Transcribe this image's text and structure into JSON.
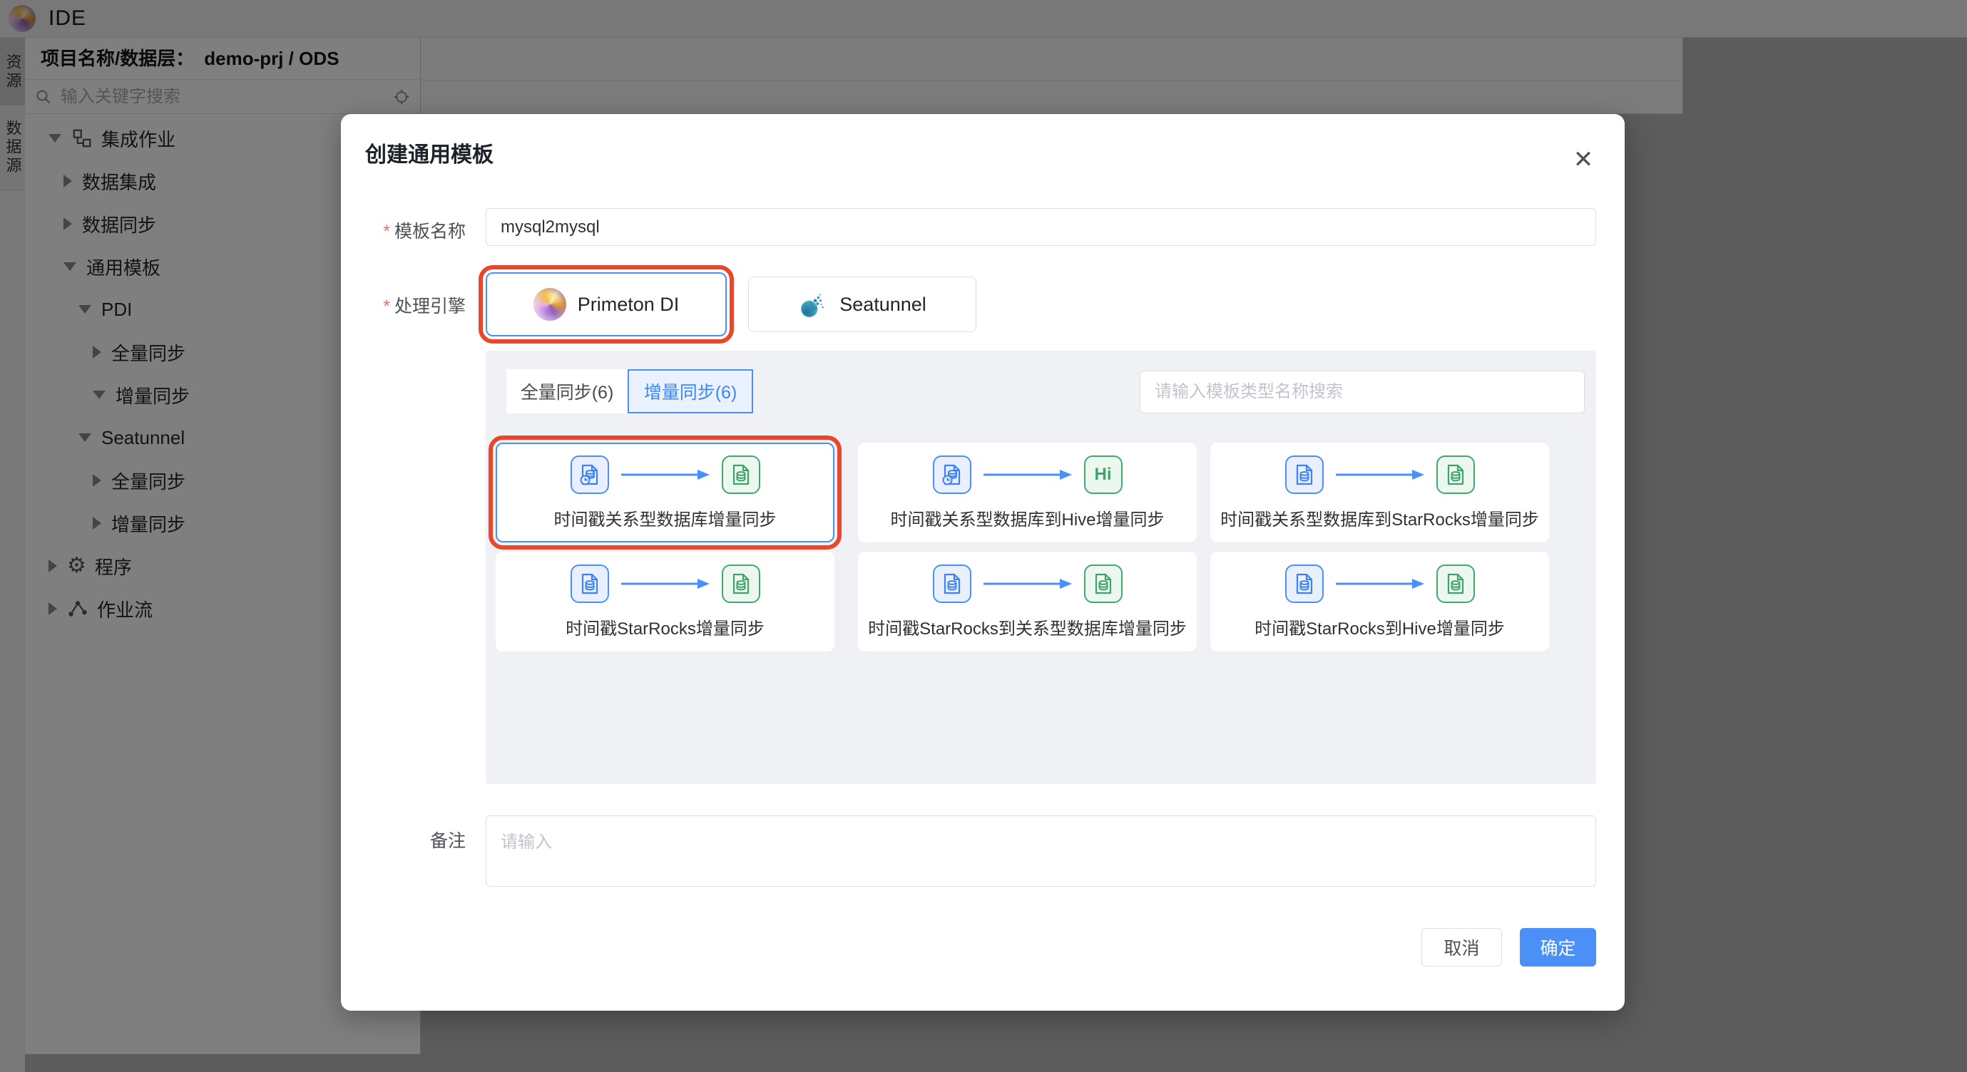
{
  "app": {
    "title": "IDE"
  },
  "rail": {
    "tabs": [
      {
        "label": "资源",
        "active": true
      },
      {
        "label": "数据源",
        "active": false
      }
    ]
  },
  "sidebar": {
    "project_label": "项目名称/数据层：",
    "project_value": "demo-prj / ODS",
    "search_placeholder": "输入关键字搜索",
    "tree": [
      {
        "label": "集成作业",
        "level": 0,
        "expanded": true,
        "icon": "hierarchy"
      },
      {
        "label": "数据集成",
        "level": 1,
        "expanded": false
      },
      {
        "label": "数据同步",
        "level": 1,
        "expanded": false
      },
      {
        "label": "通用模板",
        "level": 1,
        "expanded": true
      },
      {
        "label": "PDI",
        "level": 2,
        "expanded": true
      },
      {
        "label": "全量同步",
        "level": 3,
        "expanded": false
      },
      {
        "label": "增量同步",
        "level": 3,
        "expanded": true
      },
      {
        "label": "Seatunnel",
        "level": 2,
        "expanded": true
      },
      {
        "label": "全量同步",
        "level": 3,
        "expanded": false
      },
      {
        "label": "增量同步",
        "level": 3,
        "expanded": false
      },
      {
        "label": "程序",
        "level": 0,
        "expanded": false,
        "icon": "gear"
      },
      {
        "label": "作业流",
        "level": 0,
        "expanded": false,
        "icon": "flow"
      }
    ]
  },
  "modal": {
    "title": "创建通用模板",
    "close": "✕",
    "required_mark": "*",
    "fields": {
      "template_name": {
        "label": "模板名称",
        "required": true,
        "value": "mysql2mysql"
      },
      "engine": {
        "label": "处理引擎",
        "options": [
          {
            "label": "Primeton DI",
            "selected": true,
            "highlighted": true
          },
          {
            "label": "Seatunnel",
            "selected": false
          }
        ]
      },
      "remark": {
        "label": "备注",
        "placeholder": "请输入"
      }
    },
    "template_panel": {
      "tabs": [
        {
          "label": "全量同步(6)",
          "active": false
        },
        {
          "label": "增量同步(6)",
          "active": true
        }
      ],
      "search_placeholder": "请输入模板类型名称搜索",
      "hive_badge": "Hi",
      "cards": [
        {
          "label": "时间戳关系型数据库增量同步",
          "selected": true,
          "highlighted": true,
          "source_icon": "db-clock-blue",
          "target_icon": "db-doc-green"
        },
        {
          "label": "时间戳关系型数据库到Hive增量同步",
          "selected": false,
          "source_icon": "db-clock-blue",
          "target_icon": "hive-green"
        },
        {
          "label": "时间戳关系型数据库到StarRocks增量同步",
          "selected": false,
          "source_icon": "db-doc-blue",
          "target_icon": "db-doc-green"
        },
        {
          "label": "时间戳StarRocks增量同步",
          "selected": false,
          "source_icon": "db-doc-blue",
          "target_icon": "db-doc-green"
        },
        {
          "label": "时间戳StarRocks到关系型数据库增量同步",
          "selected": false,
          "source_icon": "db-doc-blue",
          "target_icon": "db-doc-green"
        },
        {
          "label": "时间戳StarRocks到Hive增量同步",
          "selected": false,
          "source_icon": "db-doc-blue",
          "target_icon": "db-doc-green"
        }
      ]
    },
    "footer": {
      "cancel": "取消",
      "ok": "确定"
    }
  },
  "colors": {
    "primary_blue": "#4a90f7",
    "active_tab_bg": "#e9f2fe",
    "panel_bg": "#eff1f5",
    "icon_green": "#43a86f",
    "icon_green_bg": "#ecf7f0",
    "icon_blue_bg": "#e9effd",
    "annotation_red": "#e8472b",
    "required_red": "#f56c6c"
  }
}
